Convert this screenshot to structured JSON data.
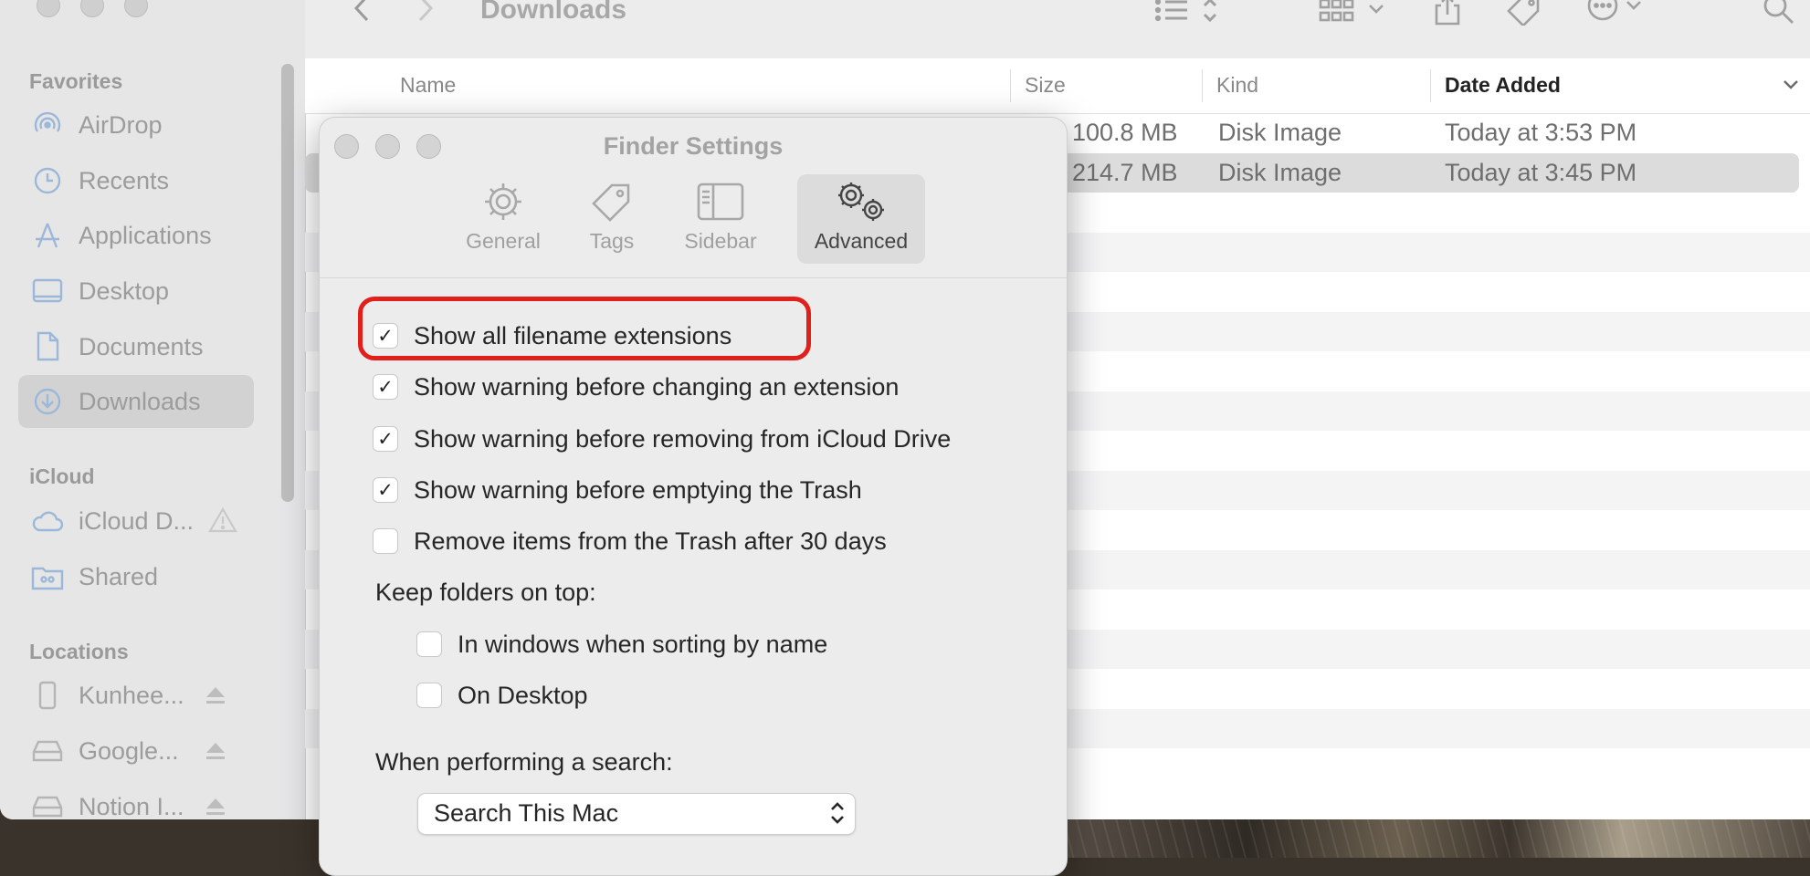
{
  "finder": {
    "window_title": "Downloads",
    "sidebar": {
      "sections": [
        {
          "title": "Favorites",
          "items": [
            {
              "label": "AirDrop",
              "icon": "airdrop-icon"
            },
            {
              "label": "Recents",
              "icon": "clock-icon"
            },
            {
              "label": "Applications",
              "icon": "applications-icon"
            },
            {
              "label": "Desktop",
              "icon": "desktop-icon"
            },
            {
              "label": "Documents",
              "icon": "document-icon"
            },
            {
              "label": "Downloads",
              "icon": "download-icon",
              "selected": true
            }
          ]
        },
        {
          "title": "iCloud",
          "items": [
            {
              "label": "iCloud D...",
              "icon": "cloud-icon"
            },
            {
              "label": "Shared",
              "icon": "shared-folder-icon"
            }
          ]
        },
        {
          "title": "Locations",
          "items": [
            {
              "label": "Kunhee...",
              "icon": "phone-icon"
            },
            {
              "label": "Google...",
              "icon": "drive-icon"
            },
            {
              "label": "Notion I...",
              "icon": "drive-icon"
            }
          ]
        }
      ]
    },
    "columns": {
      "name": "Name",
      "size": "Size",
      "kind": "Kind",
      "date_added": "Date Added"
    },
    "files": [
      {
        "size": "100.8 MB",
        "kind": "Disk Image",
        "date": "Today at 3:53 PM"
      },
      {
        "size": "214.7 MB",
        "kind": "Disk Image",
        "date": "Today at 3:45 PM",
        "selected": true
      }
    ]
  },
  "settings": {
    "title": "Finder Settings",
    "tabs": [
      {
        "label": "General",
        "icon": "gear-icon"
      },
      {
        "label": "Tags",
        "icon": "tag-icon"
      },
      {
        "label": "Sidebar",
        "icon": "sidebar-icon"
      },
      {
        "label": "Advanced",
        "icon": "gears-icon",
        "active": true
      }
    ],
    "options": [
      {
        "label": "Show all filename extensions",
        "checked": true
      },
      {
        "label": "Show warning before changing an extension",
        "checked": true
      },
      {
        "label": "Show warning before removing from iCloud Drive",
        "checked": true
      },
      {
        "label": "Show warning before emptying the Trash",
        "checked": true
      },
      {
        "label": "Remove items from the Trash after 30 days",
        "checked": false
      }
    ],
    "keep_folders_label": "Keep folders on top:",
    "keep_folders": [
      {
        "label": "In windows when sorting by name",
        "checked": false
      },
      {
        "label": "On Desktop",
        "checked": false
      }
    ],
    "search_label": "When performing a search:",
    "search_value": "Search This Mac",
    "highlight_color": "#e2201b"
  }
}
